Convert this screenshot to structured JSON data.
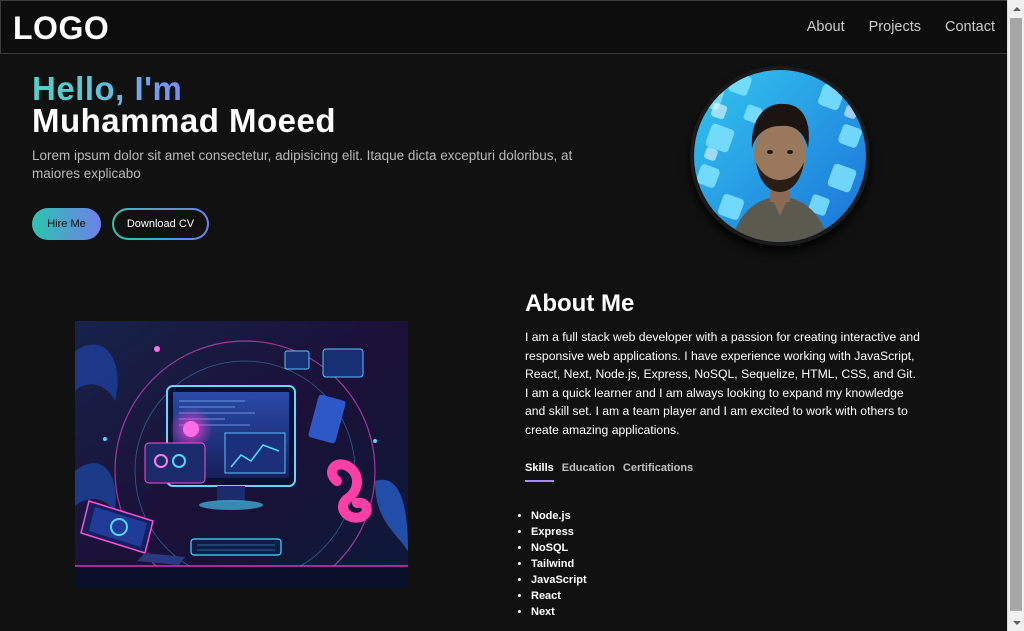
{
  "navbar": {
    "logo": "LOGO",
    "links": [
      "About",
      "Projects",
      "Contact"
    ]
  },
  "hero": {
    "greeting": "Hello, I'm",
    "name": "Muhammad Moeed",
    "intro": "Lorem ipsum dolor sit amet consectetur, adipisicing elit. Itaque dicta excepturi doloribus, at maiores explicabo",
    "hire_label": "Hire Me",
    "cv_label": "Download CV"
  },
  "about": {
    "title": "About Me",
    "text": "I am a full stack web developer with a passion for creating interactive and responsive web applications. I have experience working with JavaScript, React, Next, Node.js, Express, NoSQL, Sequelize, HTML, CSS, and Git. I am a quick learner and I am always looking to expand my knowledge and skill set. I am a team player and I am excited to work with others to create amazing applications.",
    "tabs": [
      "Skills",
      "Education",
      "Certifications"
    ],
    "active_tab": "Skills",
    "skills": [
      "Node.js",
      "Express",
      "NoSQL",
      "Tailwind",
      "JavaScript",
      "React",
      "Next"
    ]
  },
  "colors": {
    "background": "#111111",
    "gradient_start": "#2cc4b0",
    "gradient_end": "#6f7fe8",
    "tab_underline": "#a78bfa"
  }
}
